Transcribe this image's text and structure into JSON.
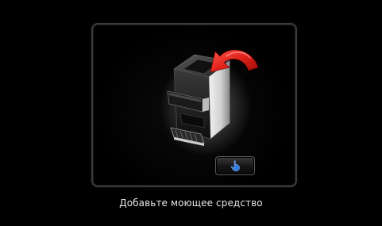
{
  "instruction": {
    "text": "Добавьте моющее средство"
  },
  "controls": {
    "confirm_icon": "hand-press-icon"
  },
  "colors": {
    "background": "#000000",
    "arrow": "#e0211b",
    "button_icon": "#2f7de1"
  }
}
